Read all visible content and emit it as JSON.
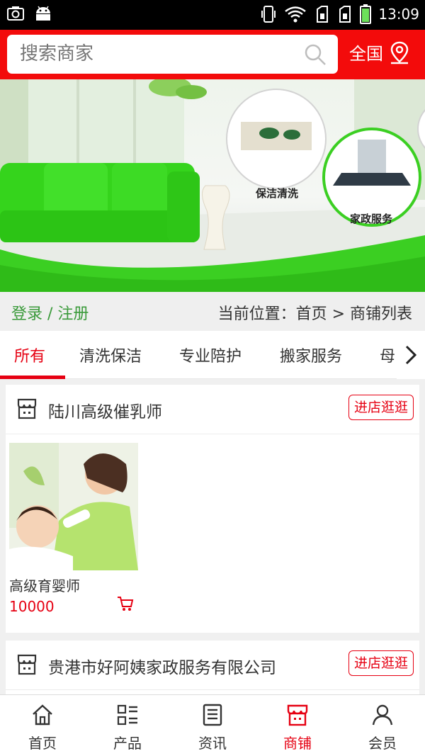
{
  "status_bar": {
    "time": "13:09"
  },
  "search": {
    "placeholder": "搜索商家",
    "region_label": "全国"
  },
  "banner": {
    "label_cleaning": "保洁清洗",
    "label_housekeeping": "家政服务"
  },
  "location_bar": {
    "login_register": "登录 / 注册",
    "breadcrumb": "当前位置：首页 > 商铺列表"
  },
  "tabs": [
    {
      "label": "所有"
    },
    {
      "label": "清洗保洁"
    },
    {
      "label": "专业陪护"
    },
    {
      "label": "搬家服务"
    },
    {
      "label": "母"
    }
  ],
  "shops": [
    {
      "name": "陆川高级催乳师",
      "enter_label": "进店逛逛",
      "products": [
        {
          "name": "高级育婴师",
          "price": "10000"
        }
      ]
    },
    {
      "name": "贵港市好阿姨家政服务有限公司",
      "enter_label": "进店逛逛"
    }
  ],
  "bottom_nav": [
    {
      "label": "首页",
      "icon": "home-icon"
    },
    {
      "label": "产品",
      "icon": "grid-list-icon"
    },
    {
      "label": "资讯",
      "icon": "news-icon"
    },
    {
      "label": "商铺",
      "icon": "store-icon"
    },
    {
      "label": "会员",
      "icon": "user-icon"
    }
  ],
  "colors": {
    "brand_red": "#f30b0b",
    "accent_red": "#e60012",
    "login_green": "#3a9a3a",
    "sofa_green": "#35d41c"
  }
}
